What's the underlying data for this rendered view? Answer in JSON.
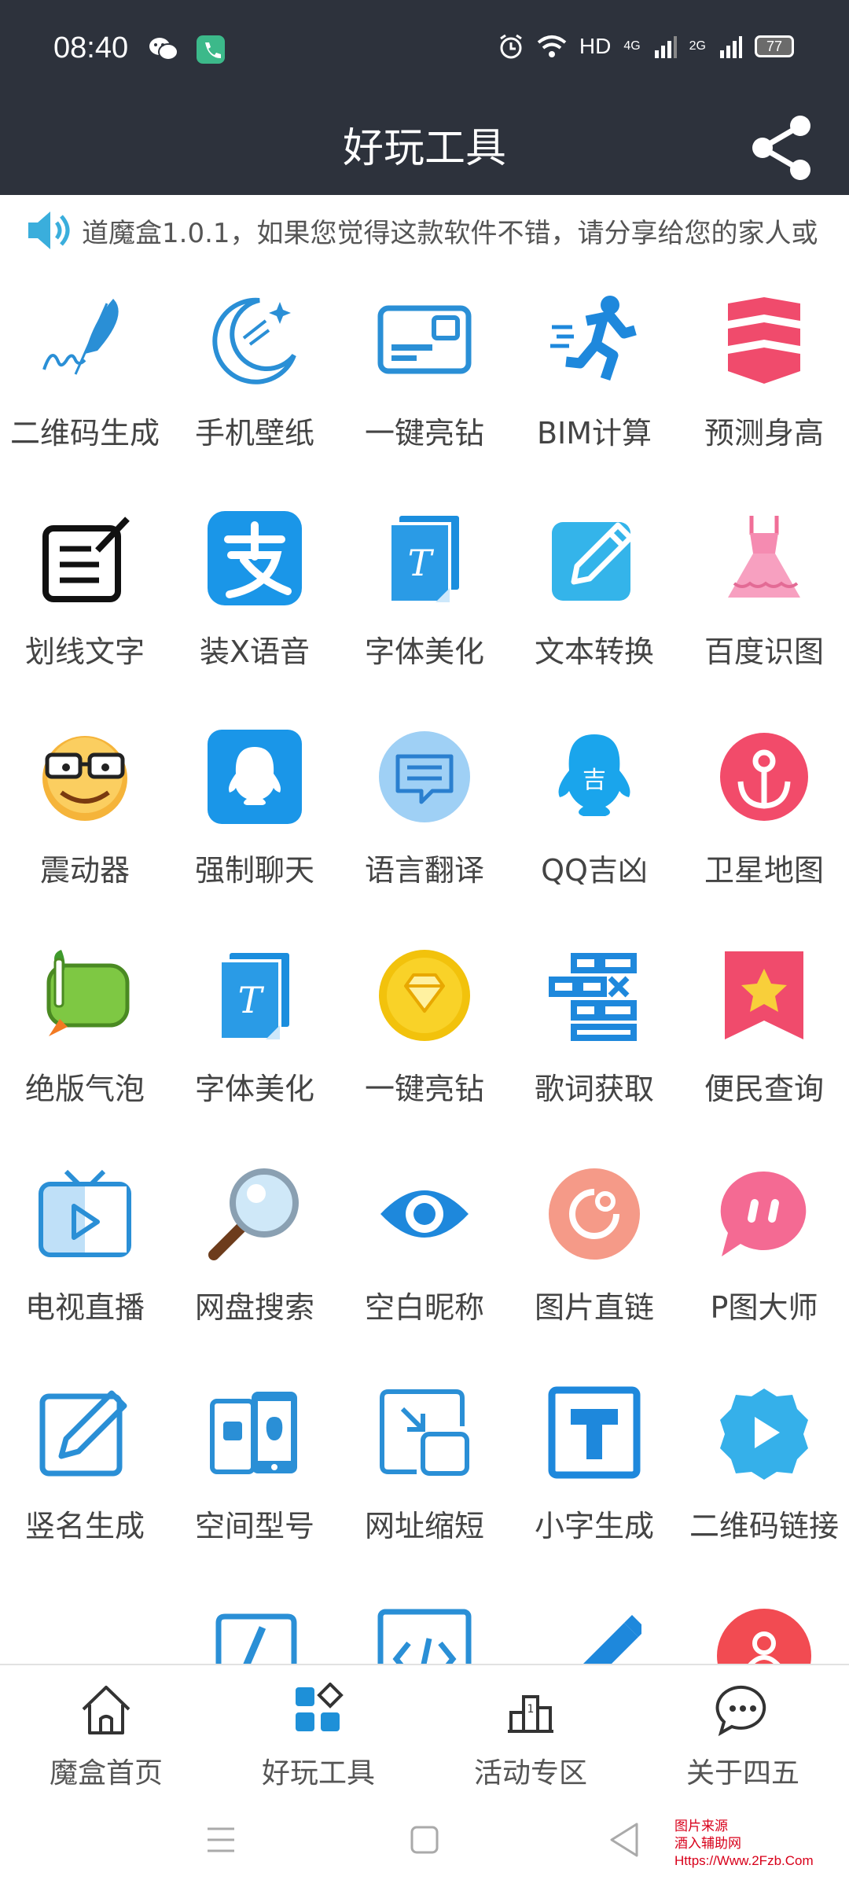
{
  "status": {
    "time": "08:40",
    "network": "HD",
    "signal_4g": "4G",
    "signal_2g": "2G",
    "battery": "77"
  },
  "header": {
    "title": "好玩工具"
  },
  "notice": {
    "text": "道魔盒1.0.1，如果您觉得这款软件不错，请分享给您的家人或"
  },
  "tools": [
    {
      "label": "二维码生成",
      "icon": "feather-signature-icon"
    },
    {
      "label": "手机壁纸",
      "icon": "moon-icon"
    },
    {
      "label": "一键亮钻",
      "icon": "card-icon"
    },
    {
      "label": "BIM计算",
      "icon": "runner-icon"
    },
    {
      "label": "预测身高",
      "icon": "chevrons-icon"
    },
    {
      "label": "划线文字",
      "icon": "edit-note-icon"
    },
    {
      "label": "装X语音",
      "icon": "alipay-icon"
    },
    {
      "label": "字体美化",
      "icon": "font-file-icon"
    },
    {
      "label": "文本转换",
      "icon": "edit-square-icon"
    },
    {
      "label": "百度识图",
      "icon": "dress-icon"
    },
    {
      "label": "震动器",
      "icon": "face-glasses-icon"
    },
    {
      "label": "强制聊天",
      "icon": "qq-icon"
    },
    {
      "label": "语言翻译",
      "icon": "chat-bubble-icon"
    },
    {
      "label": "QQ吉凶",
      "icon": "qq-luck-icon"
    },
    {
      "label": "卫星地图",
      "icon": "anchor-icon"
    },
    {
      "label": "绝版气泡",
      "icon": "veggie-bubble-icon"
    },
    {
      "label": "字体美化",
      "icon": "font-file-icon"
    },
    {
      "label": "一键亮钻",
      "icon": "diamond-coin-icon"
    },
    {
      "label": "歌词获取",
      "icon": "bricks-icon"
    },
    {
      "label": "便民查询",
      "icon": "star-bookmark-icon"
    },
    {
      "label": "电视直播",
      "icon": "tv-icon"
    },
    {
      "label": "网盘搜索",
      "icon": "magnifier-icon"
    },
    {
      "label": "空白昵称",
      "icon": "eye-icon"
    },
    {
      "label": "图片直链",
      "icon": "circle-link-icon"
    },
    {
      "label": "P图大师",
      "icon": "pink-chat-icon"
    },
    {
      "label": "竖名生成",
      "icon": "pencil-square-icon"
    },
    {
      "label": "空间型号",
      "icon": "phones-icon"
    },
    {
      "label": "网址缩短",
      "icon": "shrink-icon"
    },
    {
      "label": "小字生成",
      "icon": "letter-t-icon"
    },
    {
      "label": "二维码链接",
      "icon": "play-badge-icon"
    },
    {
      "label": "",
      "icon": "blank"
    },
    {
      "label": "",
      "icon": "pen-frame-icon"
    },
    {
      "label": "",
      "icon": "code-icon"
    },
    {
      "label": "",
      "icon": "blue-pencil-icon"
    },
    {
      "label": "",
      "icon": "red-circle-icon"
    }
  ],
  "nav": [
    {
      "label": "魔盒首页",
      "icon": "home-icon"
    },
    {
      "label": "好玩工具",
      "icon": "apps-icon"
    },
    {
      "label": "活动专区",
      "icon": "podium-icon"
    },
    {
      "label": "关于四五",
      "icon": "message-icon"
    }
  ],
  "watermark": {
    "line1": "图片来源",
    "line2": "酒入辅助网",
    "line3": "Https://Www.2Fzb.Com"
  },
  "colors": {
    "header_bg": "#2d323c",
    "accent": "#1e90d8",
    "pink": "#f24b6a"
  }
}
